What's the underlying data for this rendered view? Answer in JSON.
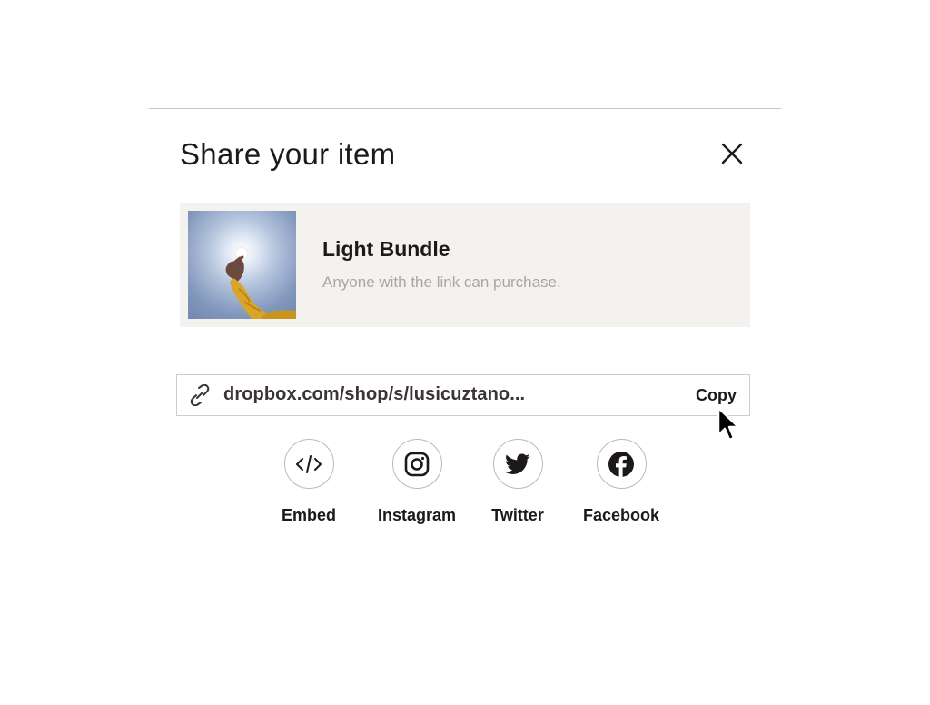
{
  "modal": {
    "title": "Share your item"
  },
  "item": {
    "name": "Light Bundle",
    "subtitle": "Anyone with the link can purchase."
  },
  "link": {
    "url": "dropbox.com/shop/s/lusicuztano...",
    "copy_label": "Copy"
  },
  "share_options": [
    {
      "label": "Embed",
      "icon": "code-icon"
    },
    {
      "label": "Instagram",
      "icon": "instagram-icon"
    },
    {
      "label": "Twitter",
      "icon": "twitter-icon"
    },
    {
      "label": "Facebook",
      "icon": "facebook-icon"
    }
  ],
  "colors": {
    "text": "#1e1919",
    "subtle_text": "#aaa5a0",
    "card_background": "#f4f2ef",
    "border": "#cfccc8"
  }
}
